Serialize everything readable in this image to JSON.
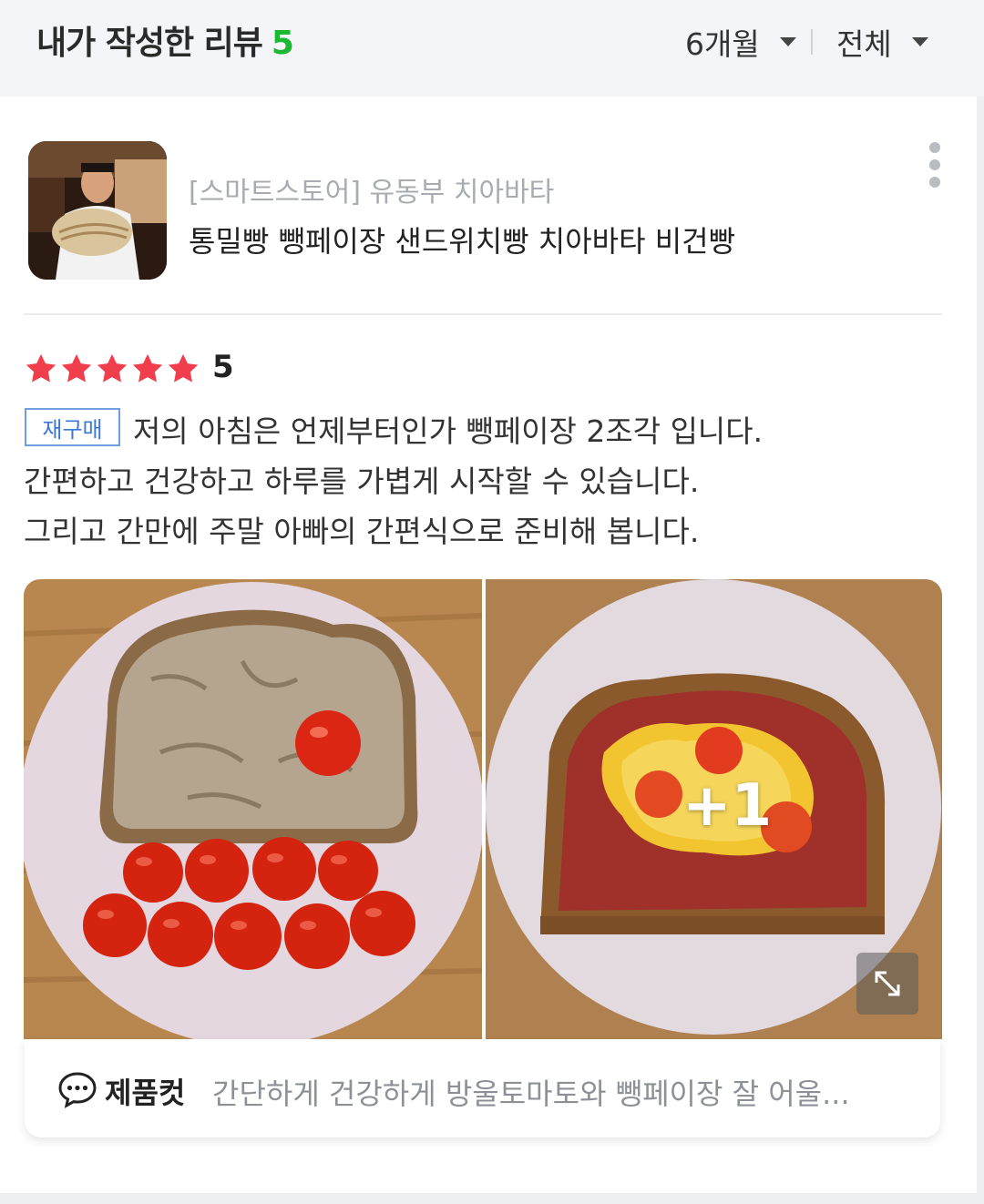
{
  "header": {
    "title": "내가 작성한 리뷰",
    "count": "5",
    "period_filter": "6개월",
    "type_filter": "전체"
  },
  "review": {
    "store": "[스마트스토어] 유동부 치아바타",
    "product": "통밀빵 뺑페이장 샌드위치빵 치아바타 비건빵",
    "rating": "5",
    "stars": 5,
    "star_color": "#f03e4d",
    "tag": "재구매",
    "lines": [
      "저의 아침은 언제부터인가 뺑페이장 2조각 입니다.",
      "간편하고 건강하고 하루를 가볍게 시작할 수 있습니다.",
      "그리고 간만에 주말 아빠의 간편식으로 준비해 봅니다."
    ],
    "extra_photos": "+1",
    "product_shot": {
      "label": "제품컷",
      "text": "간단하게 건강하게 방울토마토와 뺑페이장 잘 어울..."
    }
  },
  "icons": {
    "more": "more-vertical-icon",
    "expand": "expand-icon",
    "chat": "chat-bubble-icon",
    "caret": "caret-down-icon",
    "star": "star-icon"
  },
  "colors": {
    "count_green": "#1bb833",
    "tag_blue": "#3a77d6",
    "header_bg": "#f3f5f8"
  }
}
